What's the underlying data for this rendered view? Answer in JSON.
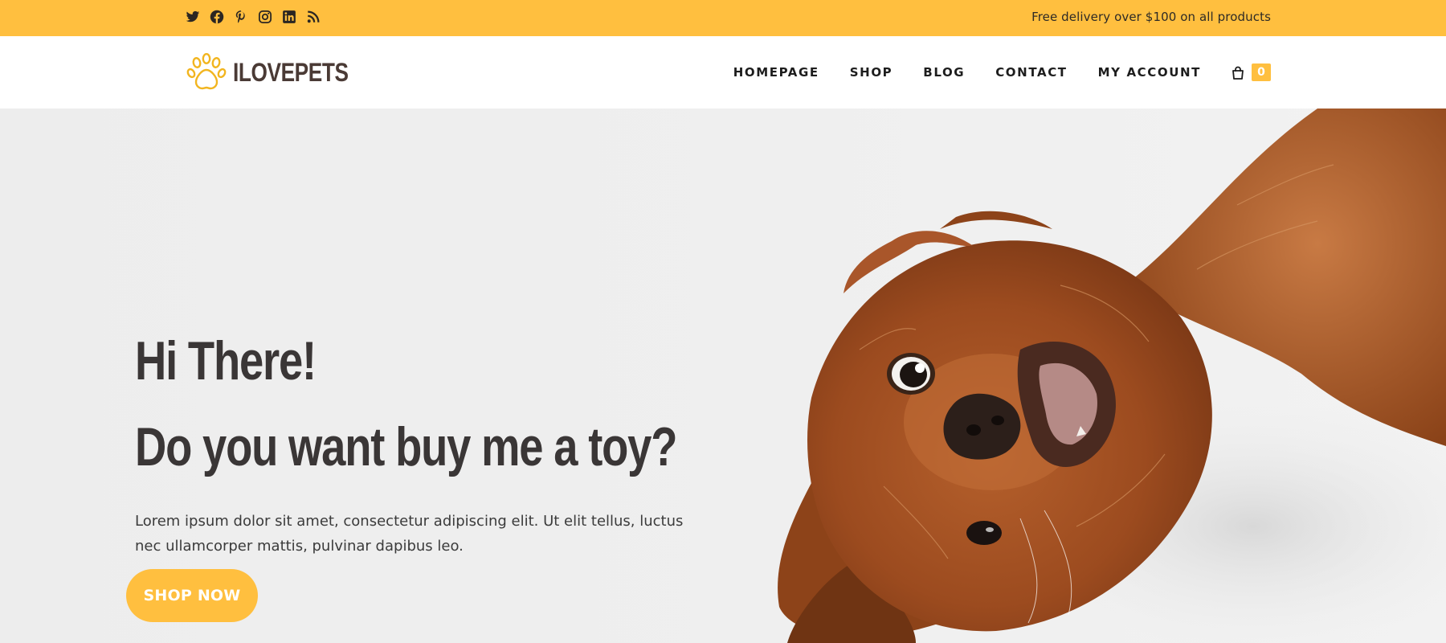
{
  "topbar": {
    "social_icons": [
      "twitter-icon",
      "facebook-icon",
      "pinterest-icon",
      "instagram-icon",
      "linkedin-icon",
      "rss-icon"
    ],
    "delivery_text": "Free delivery over $100 on all products"
  },
  "header": {
    "logo_text": "ILOVEPETS",
    "nav": {
      "homepage": "HOMEPAGE",
      "shop": "SHOP",
      "blog": "BLOG",
      "contact": "CONTACT",
      "my_account": "MY ACCOUNT"
    },
    "cart_count": "0"
  },
  "hero": {
    "title_line1": "Hi There!",
    "title_line2": "Do you want buy me a toy?",
    "description": "Lorem ipsum dolor sit amet, consectetur adipiscing elit. Ut elit tellus, luctus nec ullamcorper mattis, pulvinar dapibus leo.",
    "button_label": "SHOP NOW"
  },
  "colors": {
    "accent": "#ffbf3f",
    "heading": "#3a3636",
    "logo_text": "#4a3a35",
    "hero_background": "#efefef"
  }
}
